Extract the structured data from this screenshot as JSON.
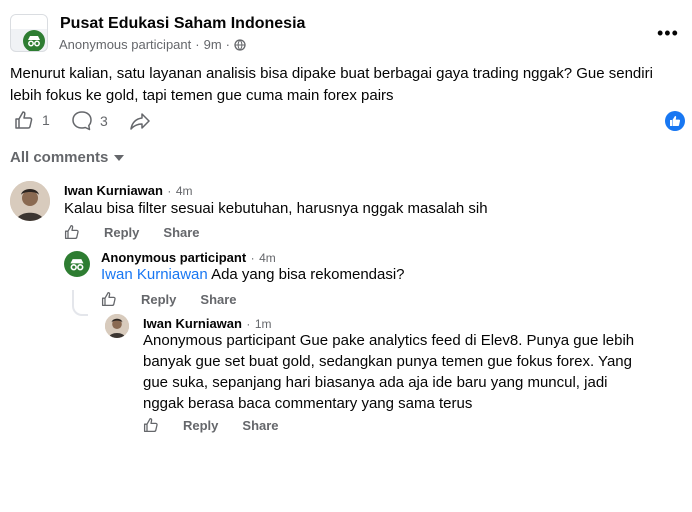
{
  "post": {
    "group_name": "Pusat Edukasi Saham Indonesia",
    "author": "Anonymous participant",
    "separator": "·",
    "time": "9m",
    "more_icon": "•••",
    "body": "Menurut kalian, satu layanan analisis bisa dipake buat berbagai gaya trading nggak? Gue sendiri lebih fokus ke gold, tapi temen gue cuma main forex pairs",
    "like_count": "1",
    "comment_count": "3"
  },
  "comments_header": {
    "label": "All comments"
  },
  "comments": [
    {
      "name": "Iwan Kurniawan",
      "time": "4m",
      "text": "Kalau bisa filter sesuai kebutuhan, harusnya nggak masalah sih",
      "reply_label": "Reply",
      "share_label": "Share"
    },
    {
      "name": "Anonymous participant",
      "time": "4m",
      "mention": "Iwan Kurniawan",
      "text": " Ada yang bisa rekomendasi?",
      "reply_label": "Reply",
      "share_label": "Share"
    },
    {
      "name": "Iwan Kurniawan",
      "time": "1m",
      "text": "Anonymous participant Gue pake analytics feed di Elev8. Punya gue lebih banyak gue set buat gold, sedangkan punya temen gue fokus forex. Yang gue suka, sepanjang hari biasanya ada aja ide baru yang muncul, jadi nggak berasa baca commentary yang sama terus",
      "reply_label": "Reply",
      "share_label": "Share"
    }
  ],
  "colors": {
    "accent": "#1877f2",
    "muted": "#65676b",
    "anon_green": "#2e7d32"
  }
}
